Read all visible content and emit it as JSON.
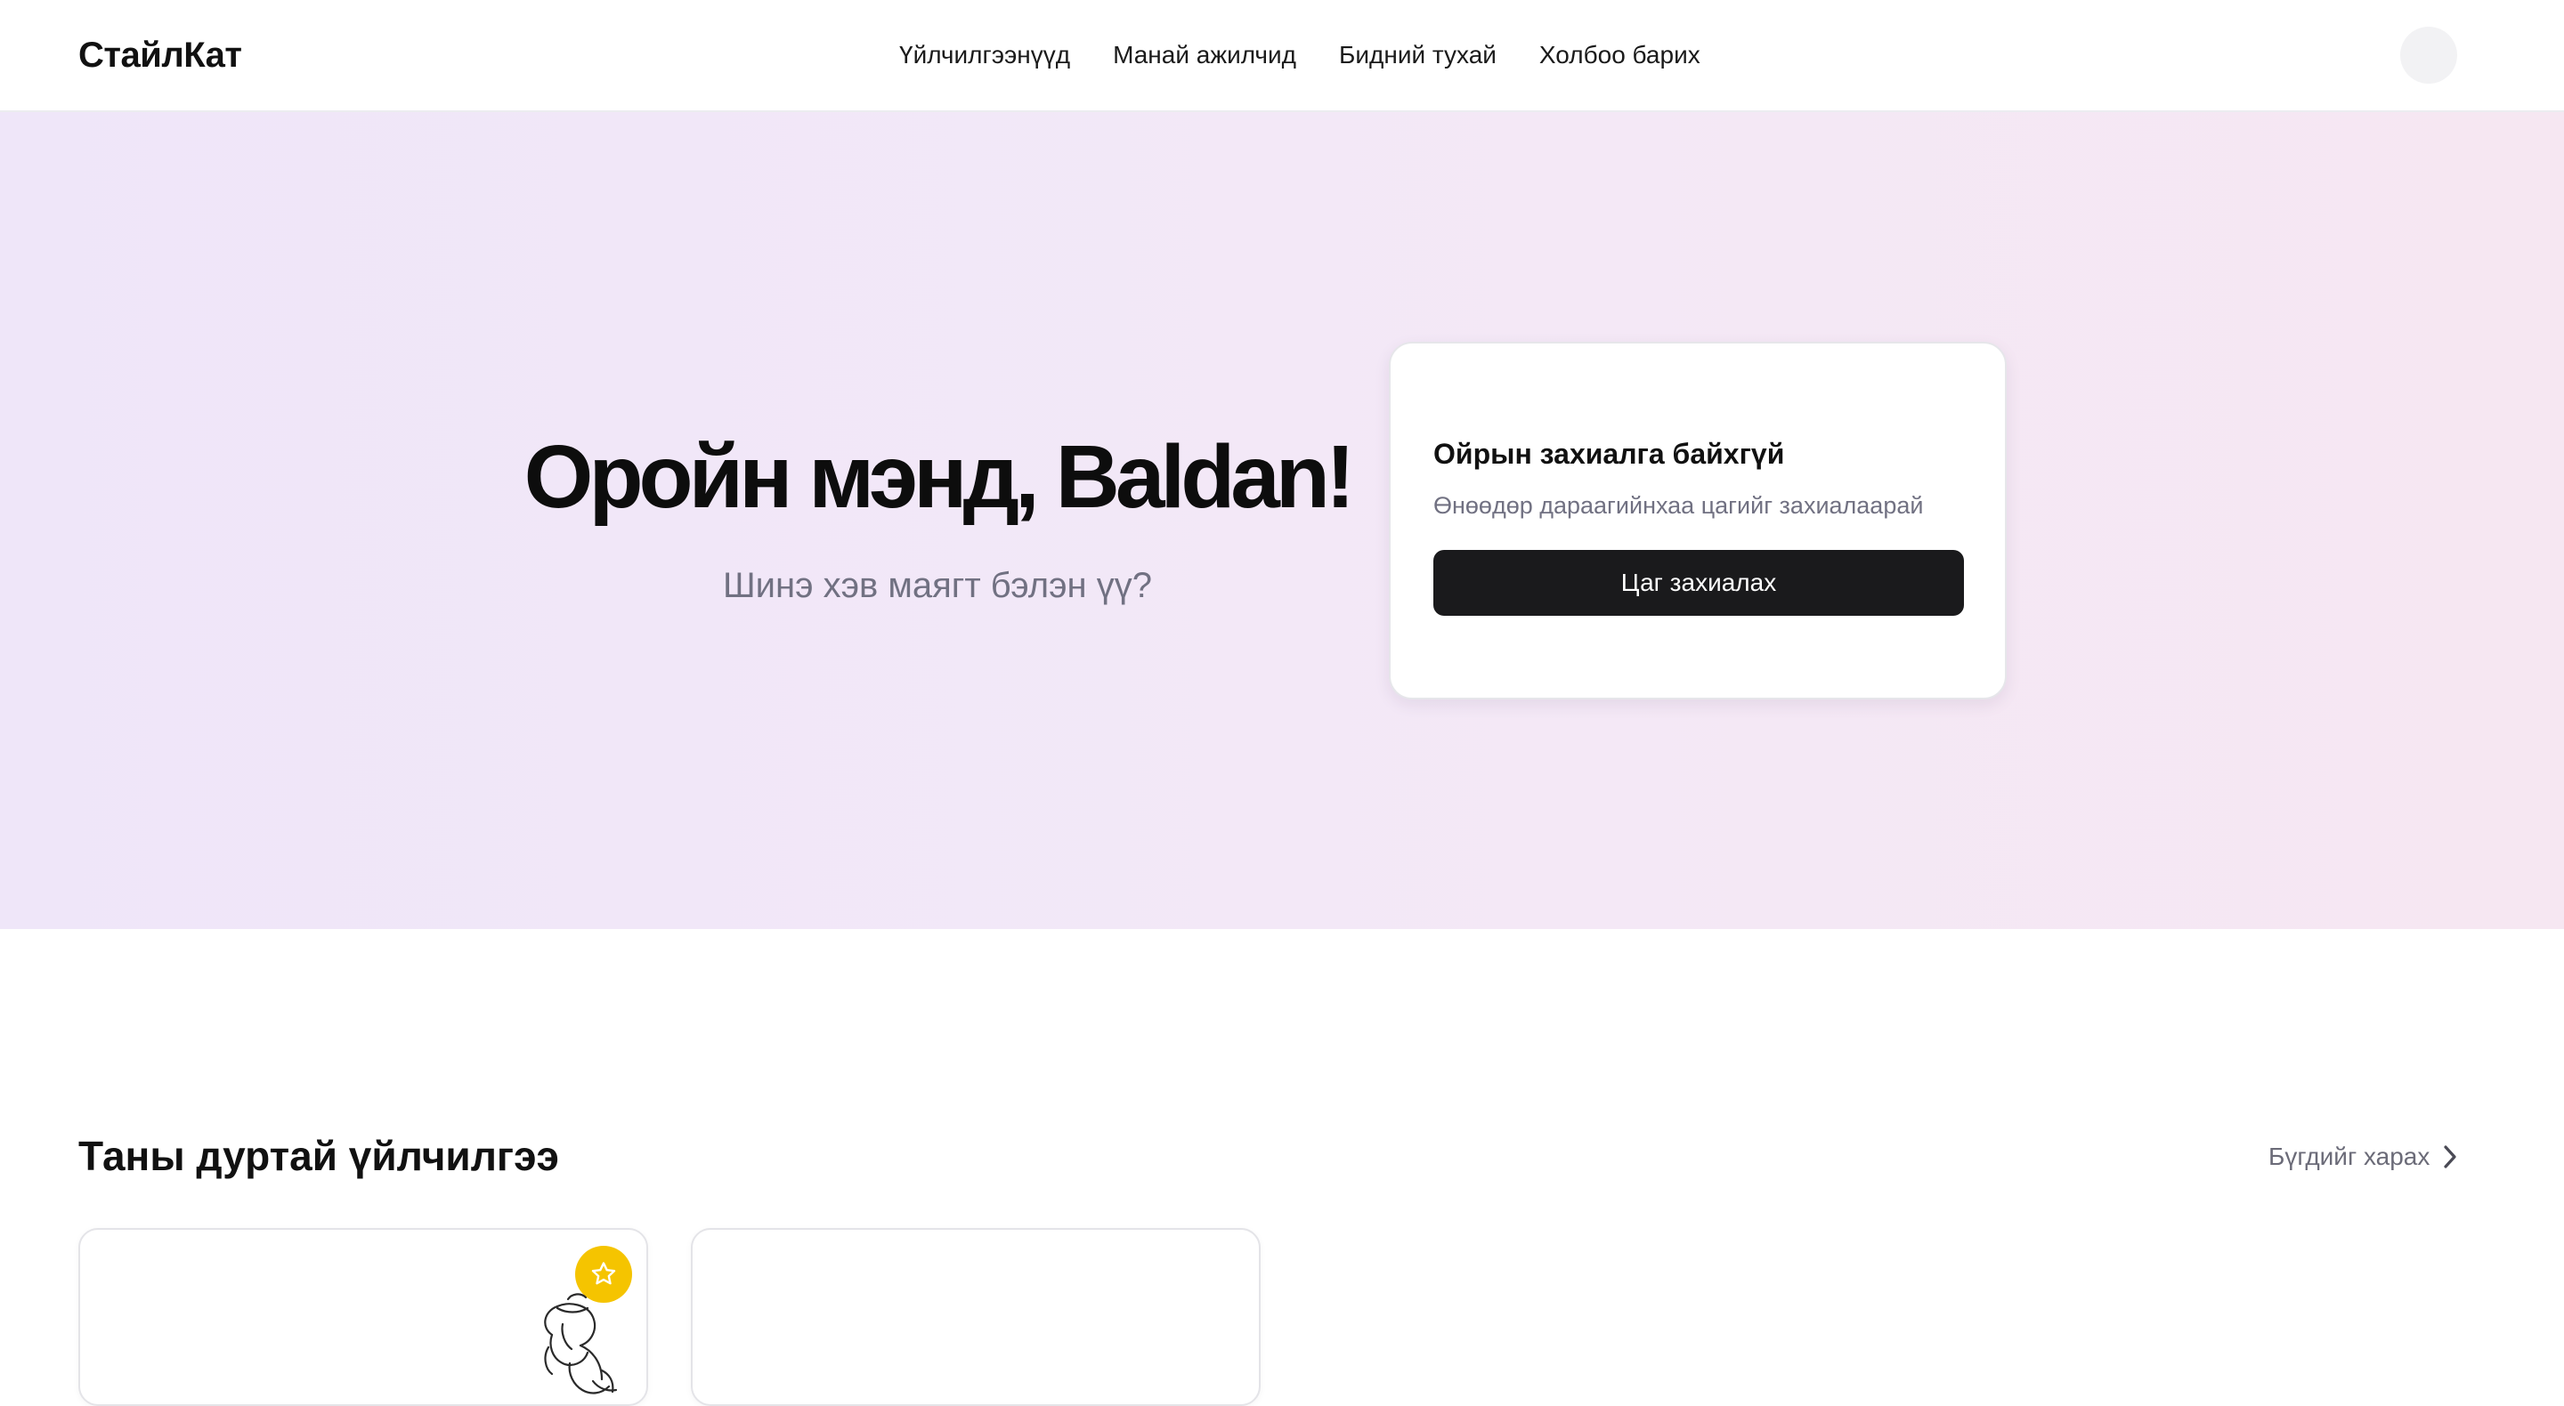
{
  "header": {
    "logo": "СтайлКат",
    "nav": [
      {
        "label": "Үйлчилгээнүүд"
      },
      {
        "label": "Манай ажилчид"
      },
      {
        "label": "Бидний тухай"
      },
      {
        "label": "Холбоо барих"
      }
    ]
  },
  "hero": {
    "greeting": "Оройн мэнд, Baldan!",
    "subtitle": "Шинэ хэв маягт бэлэн үү?"
  },
  "booking_card": {
    "title": "Ойрын захиалга байхгүй",
    "description": "Өнөөдөр дараагийнхаа цагийг захиалаарай",
    "button_label": "Цаг захиалах"
  },
  "favorites": {
    "title": "Таны дуртай үйлчилгээ",
    "view_all_label": "Бүгдийг харах",
    "view_all_icon": "chevron-right-icon",
    "cards": [
      {
        "favorite_icon": "star-icon",
        "image_icon": "stylist-line-art"
      },
      {}
    ]
  },
  "colors": {
    "accent_favorite": "#f5c400",
    "button_dark": "#1a1a1c",
    "muted_text": "#717182",
    "hero_gradient_start": "#efe6f9",
    "hero_gradient_end": "#f6e7f2"
  }
}
